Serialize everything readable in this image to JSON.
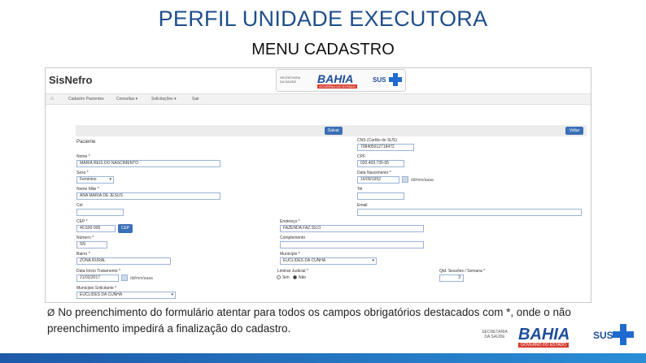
{
  "slide": {
    "title": "PERFIL UNIDADE EXECUTORA",
    "subtitle": "MENU CADASTRO",
    "note_bullet": "Ø",
    "note": "No preenchimento do formulário atentar para todos os campos obrigatórios destacados com *, onde o não preenchimento impedirá a finalização do cadastro."
  },
  "app": {
    "logo": "SisNefro",
    "nav": [
      "Cadastro Pacientes",
      "Consultas ▾",
      "Solicitações ▾",
      "Sair"
    ],
    "buttons": {
      "save": "Salvar",
      "back": "Voltar",
      "cep": "CEP"
    }
  },
  "gov_logo": {
    "secretaria": "SECRETARIA DA SAÚDE",
    "bahia": "BAHIA",
    "governo": "GOVERNO DO ESTADO",
    "sus": "SUS"
  },
  "form": {
    "section_label": "Paciente",
    "cns_label": "CNS (Cartão do SUS)",
    "cns_value": "708405012718472",
    "nome_label": "Nome *",
    "nome_value": "MARIA REIS DO NASCIMENTO",
    "cpf_label": "CPF",
    "cpf_value": "020.409.735-05",
    "sexo_label": "Sexo *",
    "sexo_value": "Feminino",
    "nasc_label": "Data Nascimento *",
    "nasc_value": "16/09/1952",
    "date_hint": "dd/mm/aaaa",
    "mae_label": "Nome Mãe *",
    "mae_value": "ANA MARIA DE JESUS",
    "tel_label": "Tel",
    "cel_label": "Cel",
    "email_label": "Email",
    "cep_label": "CEP *",
    "cep_value": "40.500-000",
    "endereco_label": "Endereço *",
    "endereco_value": "FAZENDA FAZ.SILO",
    "numero_label": "Número *",
    "numero_value": "SN",
    "complemento_label": "Complemento",
    "bairro_label": "Bairro *",
    "bairro_value": "ZONA RURAL",
    "municipio_label": "Município *",
    "municipio_value": "EUCLIDES DA CUNHA",
    "tratamento_label": "Data Início Tratamento *",
    "tratamento_value": "21/02/2017",
    "liminar_label": "Liminar Judicial *",
    "liminar_yes": "Sim",
    "liminar_no": "Não",
    "sessoes_label": "Qtd. Sessões / Semana *",
    "sessoes_value": "3",
    "municipio_sol_label": "Município Solicitante *",
    "municipio_sol_value": "EUCLIDES DA CUNHA"
  }
}
